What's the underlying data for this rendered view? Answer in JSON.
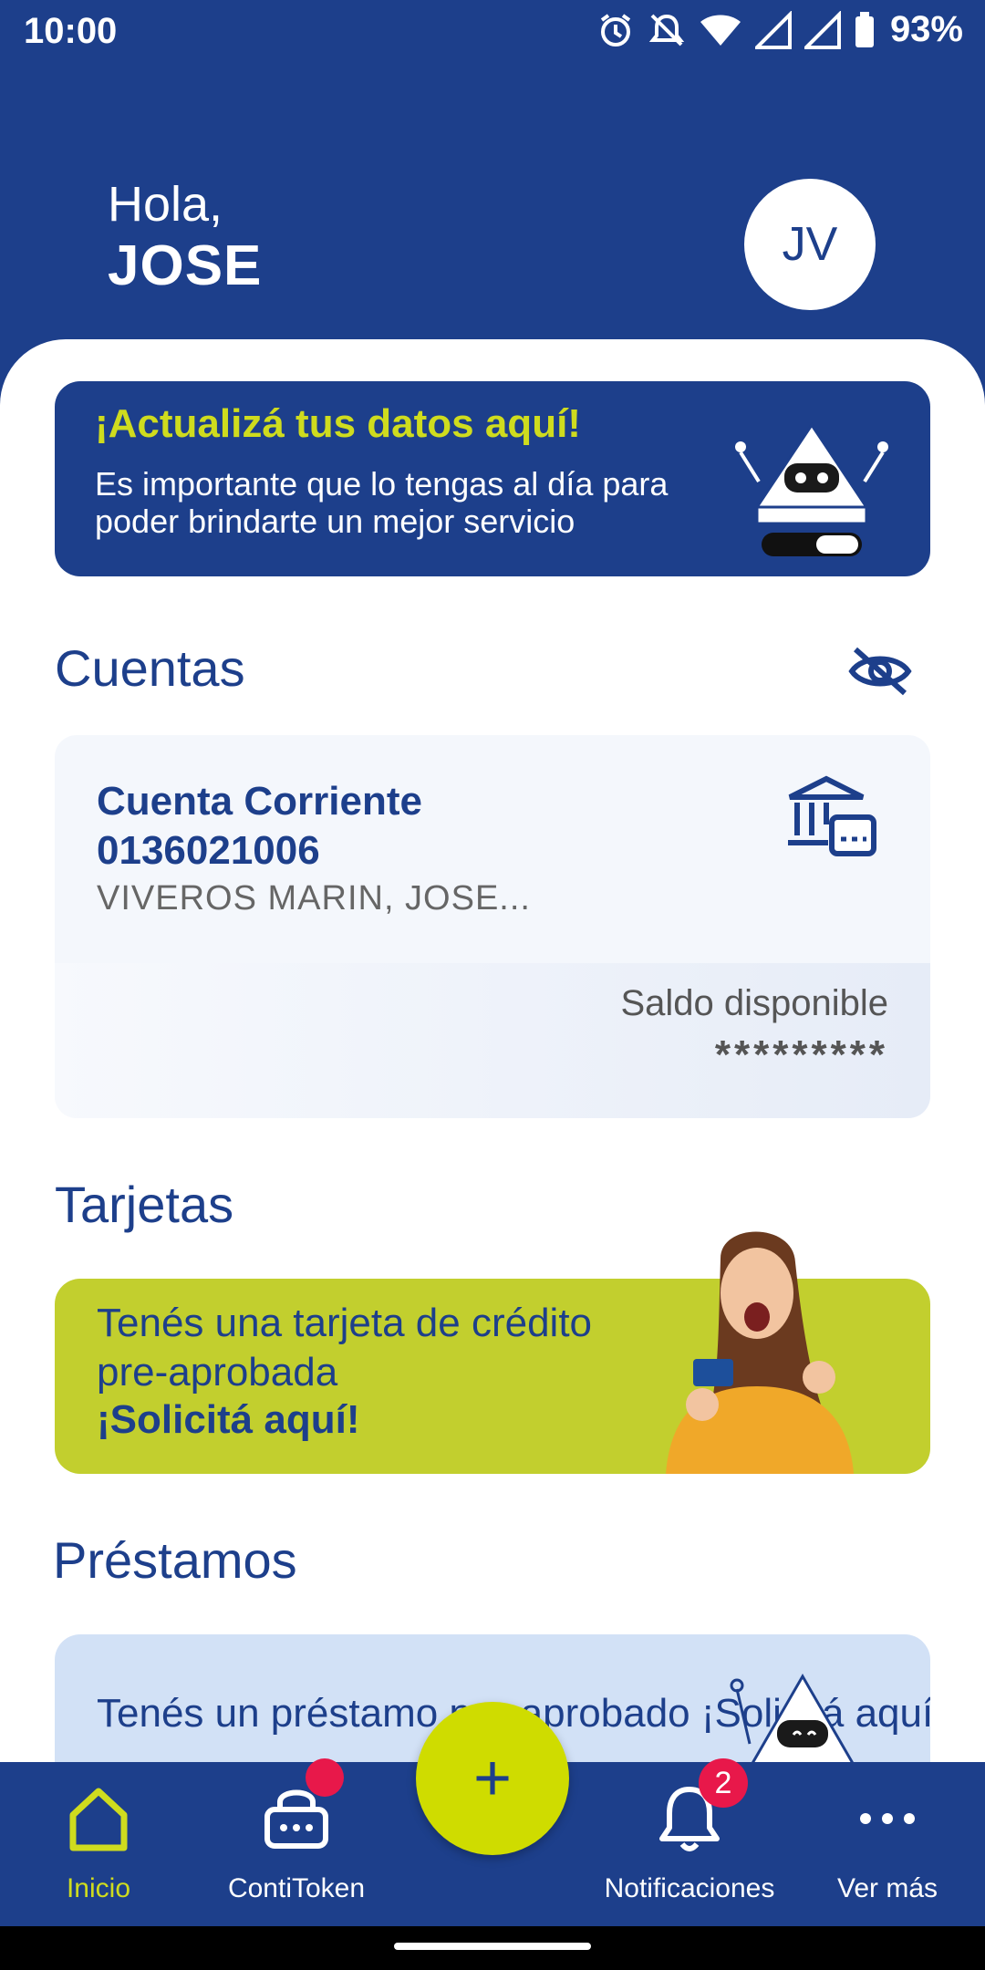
{
  "status": {
    "time": "10:00",
    "battery": "93%"
  },
  "header": {
    "greeting": "Hola,",
    "name": "JOSE",
    "avatar_initials": "JV"
  },
  "update_banner": {
    "title": "¡Actualizá tus datos aquí!",
    "text": "Es importante que lo tengas al día para poder brindarte un mejor servicio"
  },
  "accounts": {
    "title": "Cuentas",
    "card": {
      "type": "Cuenta Corriente",
      "number": "0136021006",
      "owner": "VIVEROS MARIN, JOSE...",
      "balance_label": "Saldo disponible",
      "balance_value": "*********"
    }
  },
  "cards": {
    "title": "Tarjetas",
    "banner_text": "Tenés una tarjeta de crédito pre-aprobada",
    "banner_cta": "¡Solicitá aquí!"
  },
  "loans": {
    "title": "Préstamos",
    "banner_text": "Tenés un préstamo pre-aprobado ¡Solicitá aquí!"
  },
  "nav": {
    "items": [
      {
        "label": "Inicio"
      },
      {
        "label": "ContiToken"
      },
      {
        "label": "Notificaciones",
        "badge": "2"
      },
      {
        "label": "Ver más"
      }
    ]
  },
  "fab": {
    "symbol": "+"
  },
  "colors": {
    "primary": "#1d3f8b",
    "accent": "#cfdc1e",
    "promo": "#c2cf2e",
    "badge": "#e8184a"
  }
}
